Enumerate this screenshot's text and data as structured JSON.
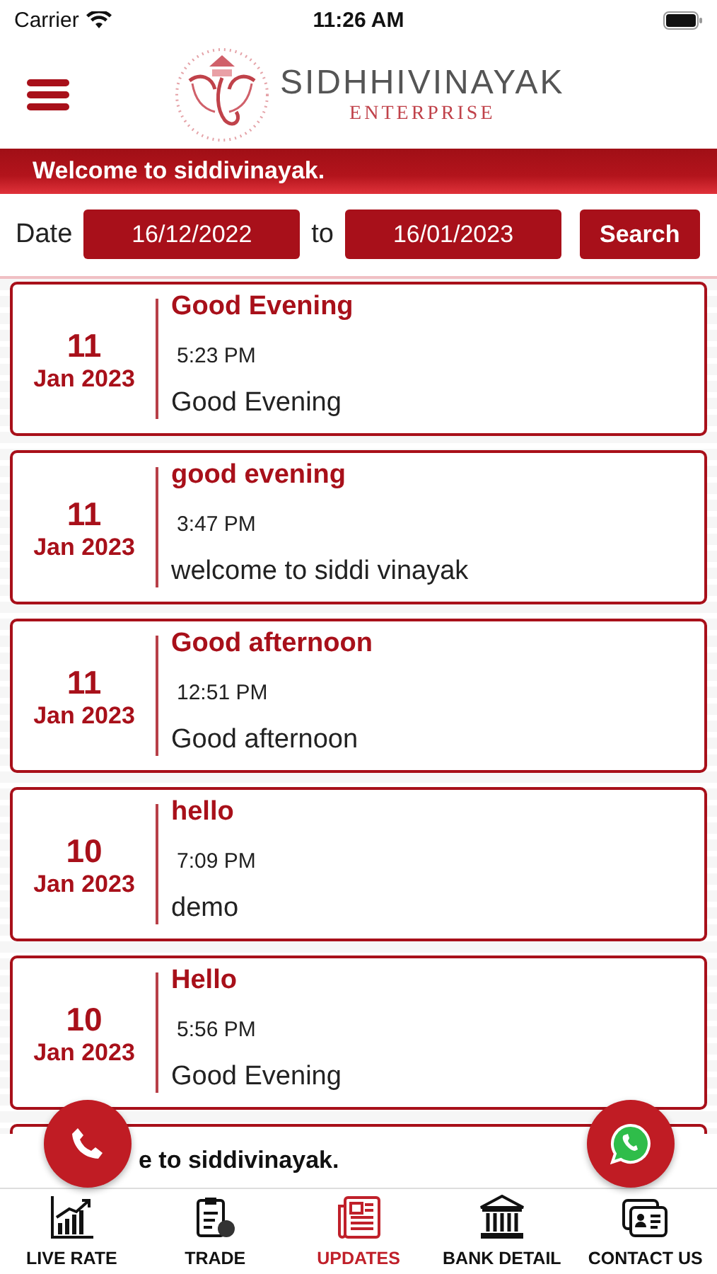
{
  "status_bar": {
    "carrier": "Carrier",
    "time": "11:26 AM"
  },
  "header": {
    "brand": "SIDHHIVINAYAK",
    "tagline": "ENTERPRISE"
  },
  "banner": "Welcome to siddivinayak.",
  "filter": {
    "label": "Date",
    "from": "16/12/2022",
    "separator": "to",
    "to": "16/01/2023",
    "button": "Search"
  },
  "updates": [
    {
      "day": "11",
      "month_year": "Jan 2023",
      "title": "Good Evening",
      "time": "5:23 PM",
      "message": "Good Evening"
    },
    {
      "day": "11",
      "month_year": "Jan 2023",
      "title": "good evening",
      "time": "3:47 PM",
      "message": "welcome to siddi vinayak"
    },
    {
      "day": "11",
      "month_year": "Jan 2023",
      "title": "Good afternoon",
      "time": "12:51 PM",
      "message": "Good afternoon"
    },
    {
      "day": "10",
      "month_year": "Jan 2023",
      "title": "hello",
      "time": "7:09 PM",
      "message": "demo"
    },
    {
      "day": "10",
      "month_year": "Jan 2023",
      "title": "Hello",
      "time": "5:56 PM",
      "message": "Good Evening"
    }
  ],
  "ticker": "e to siddivinayak.",
  "tabs": [
    {
      "kind": "chart",
      "label": "LIVE RATE",
      "selected": false
    },
    {
      "kind": "clipboard",
      "label": "TRADE",
      "selected": false
    },
    {
      "kind": "news",
      "label": "UPDATES",
      "selected": true
    },
    {
      "kind": "bank",
      "label": "BANK DETAIL",
      "selected": false
    },
    {
      "kind": "contact",
      "label": "CONTACT US",
      "selected": false
    }
  ]
}
